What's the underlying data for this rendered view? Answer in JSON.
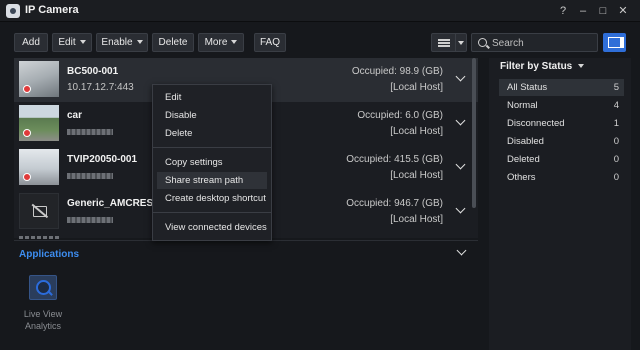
{
  "window": {
    "title": "IP Camera",
    "controls": {
      "help": "?",
      "minimize": "–",
      "maximize": "□",
      "close": "✕"
    }
  },
  "toolbar": {
    "add": "Add",
    "edit": "Edit",
    "enable": "Enable",
    "delete": "Delete",
    "more": "More",
    "faq": "FAQ",
    "search_placeholder": "Search"
  },
  "cameras": [
    {
      "name": "BC500-001",
      "ip": "10.17.12.7:443",
      "occupied": "Occupied: 98.9 (GB)",
      "host": "[Local Host]",
      "recording": true,
      "selected": true
    },
    {
      "name": "car",
      "ip": "",
      "occupied": "Occupied: 6.0 (GB)",
      "host": "[Local Host]",
      "recording": true,
      "selected": false
    },
    {
      "name": "TVIP20050-001",
      "ip": "",
      "occupied": "Occupied: 415.5 (GB)",
      "host": "[Local Host]",
      "recording": true,
      "selected": false
    },
    {
      "name": "Generic_AMCREST-(",
      "ip": "",
      "occupied": "Occupied: 946.7 (GB)",
      "host": "[Local Host]",
      "recording": false,
      "selected": false
    }
  ],
  "context_menu": {
    "items": [
      "Edit",
      "Disable",
      "Delete",
      "Copy settings",
      "Share stream path",
      "Create desktop shortcut",
      "View connected devices"
    ],
    "hovered": "Share stream path"
  },
  "applications": {
    "title": "Applications",
    "tile_label": "Live View Analytics"
  },
  "filter": {
    "title": "Filter by Status",
    "statuses": [
      {
        "label": "All Status",
        "count": "5"
      },
      {
        "label": "Normal",
        "count": "4"
      },
      {
        "label": "Disconnected",
        "count": "1"
      },
      {
        "label": "Disabled",
        "count": "0"
      },
      {
        "label": "Deleted",
        "count": "0"
      },
      {
        "label": "Others",
        "count": "0"
      }
    ]
  },
  "colors": {
    "accent": "#2f6ed8",
    "link": "#3d8df0",
    "record": "#e03a3a"
  }
}
